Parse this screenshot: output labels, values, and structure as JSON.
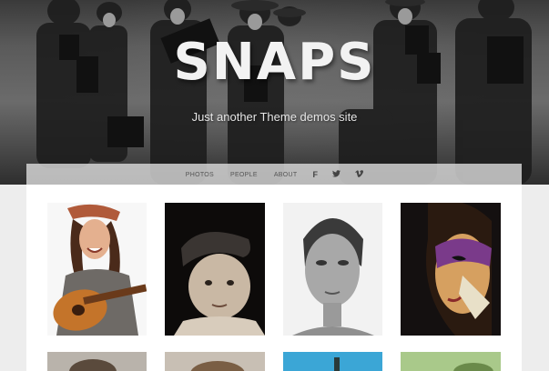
{
  "site": {
    "title": "SNAPS",
    "tagline": "Just another Theme demos site"
  },
  "nav": {
    "items": [
      "PHOTOS",
      "PEOPLE",
      "ABOUT"
    ],
    "social": [
      {
        "icon": "facebook-icon",
        "glyph": "f"
      },
      {
        "icon": "twitter-icon",
        "glyph": "t"
      },
      {
        "icon": "vimeo-icon",
        "glyph": "v"
      }
    ]
  },
  "gallery": {
    "row1": [
      {
        "subject": "woman-with-guitar"
      },
      {
        "subject": "boy-in-cap"
      },
      {
        "subject": "woman-portrait"
      },
      {
        "subject": "masked-face"
      }
    ],
    "row2": [
      {
        "subject": "portrait"
      },
      {
        "subject": "portrait"
      },
      {
        "subject": "water"
      },
      {
        "subject": "outdoor"
      }
    ]
  }
}
